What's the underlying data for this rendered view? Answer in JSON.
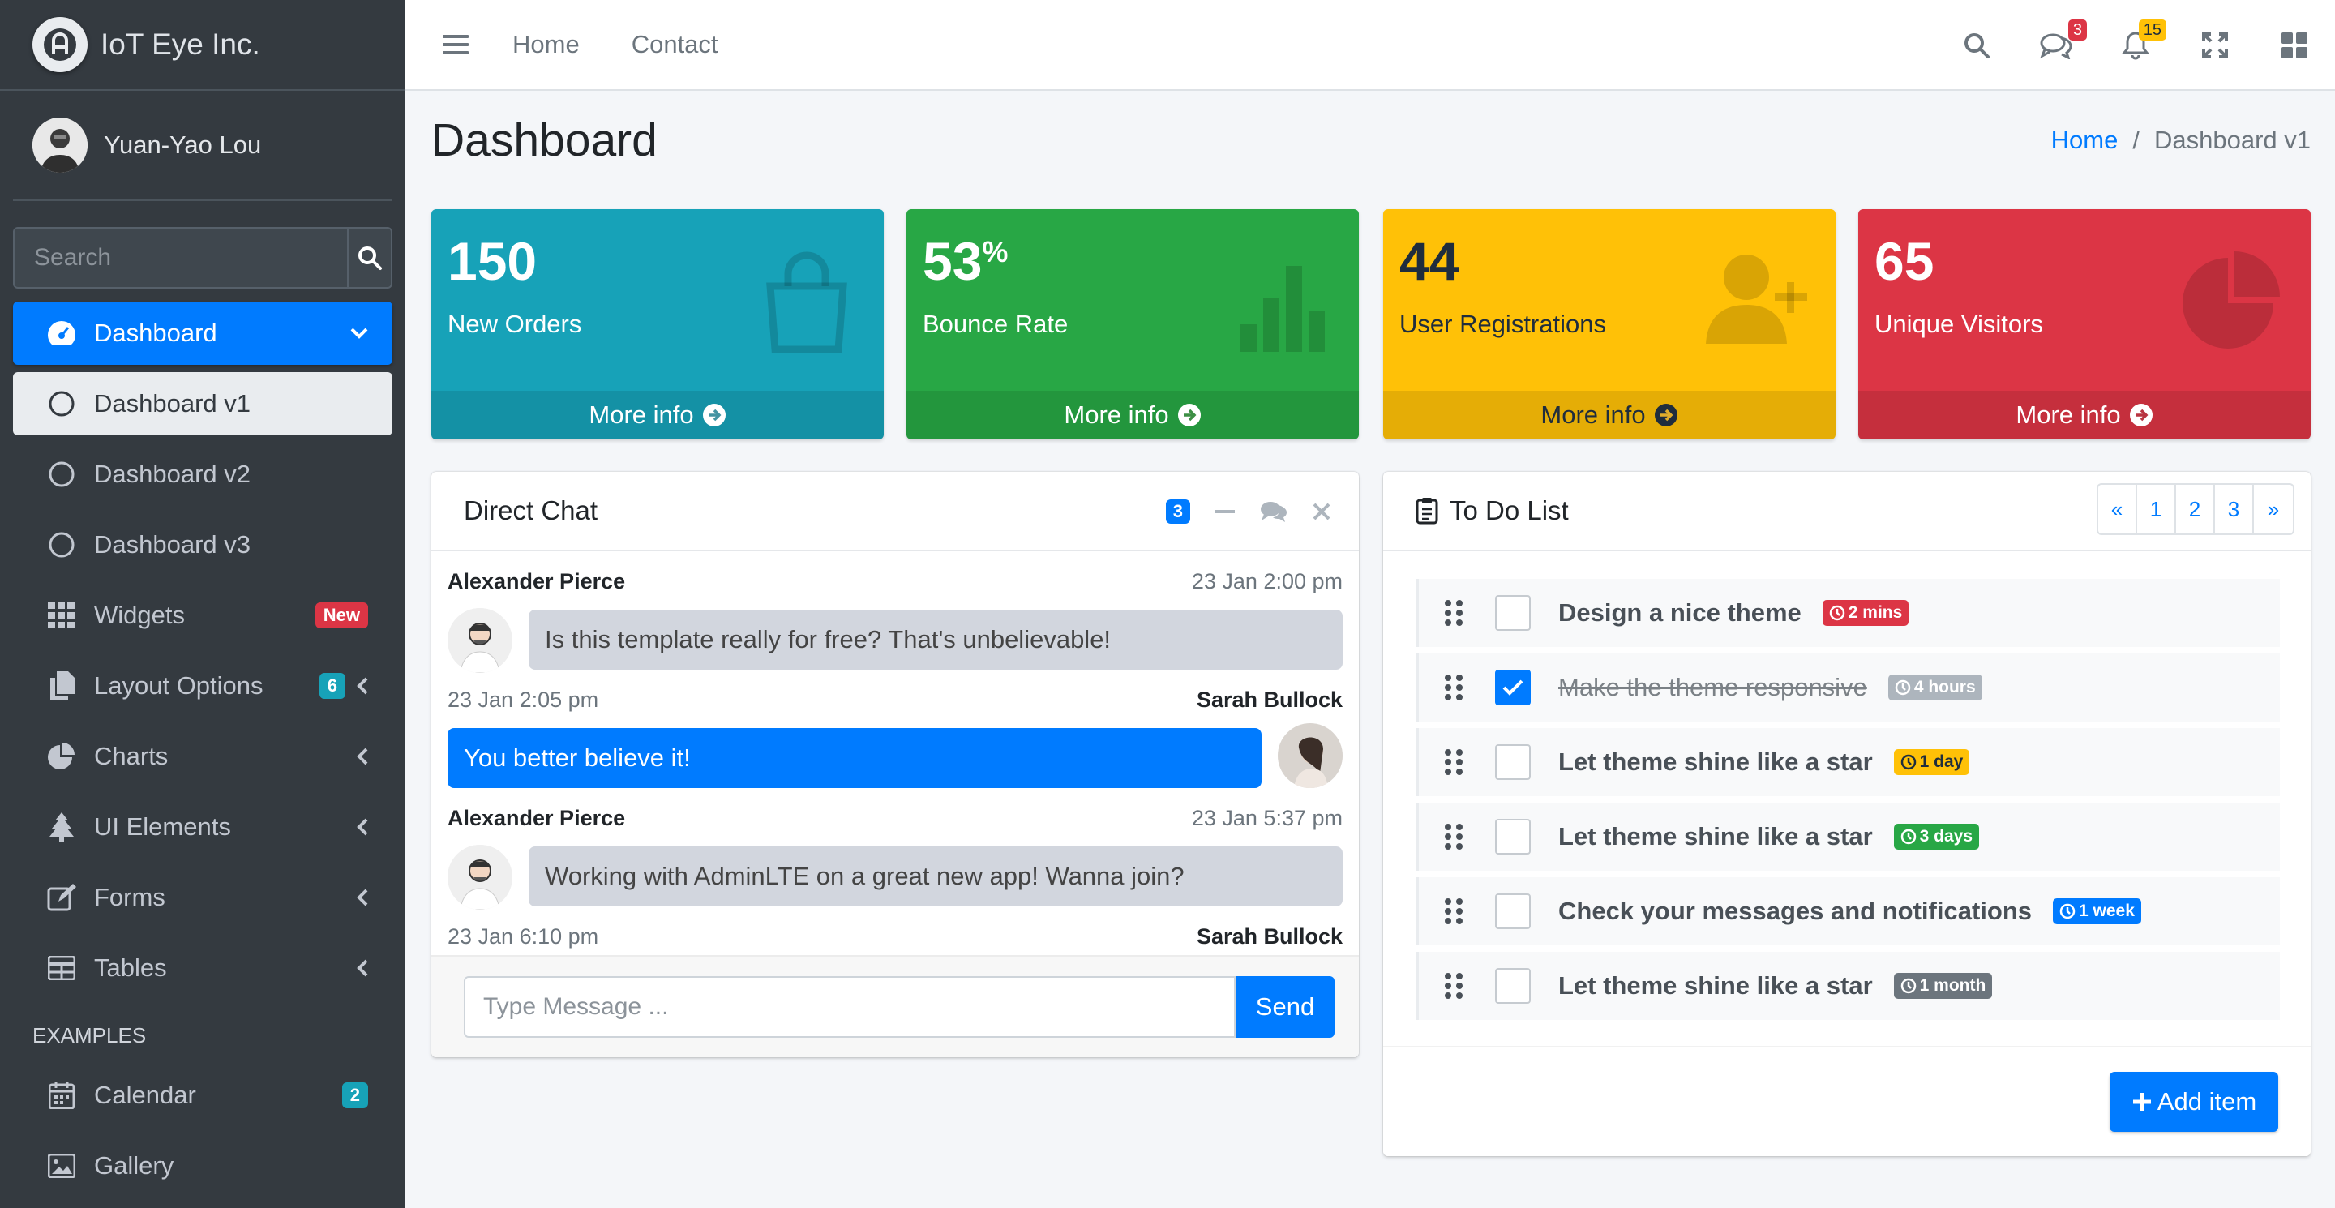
{
  "brand": {
    "name": "IoT Eye Inc."
  },
  "user": {
    "name": "Yuan-Yao Lou"
  },
  "sidebar": {
    "search_placeholder": "Search",
    "items": [
      {
        "label": "Dashboard",
        "icon": "tachometer-icon"
      },
      {
        "label": "Dashboard v1",
        "icon": "circle-icon"
      },
      {
        "label": "Dashboard v2",
        "icon": "circle-icon"
      },
      {
        "label": "Dashboard v3",
        "icon": "circle-icon"
      },
      {
        "label": "Widgets",
        "icon": "grid-icon",
        "badge": "New"
      },
      {
        "label": "Layout Options",
        "icon": "copy-icon",
        "badge": "6"
      },
      {
        "label": "Charts",
        "icon": "pie-chart-icon"
      },
      {
        "label": "UI Elements",
        "icon": "tree-icon"
      },
      {
        "label": "Forms",
        "icon": "edit-icon"
      },
      {
        "label": "Tables",
        "icon": "table-icon"
      }
    ],
    "header": "EXAMPLES",
    "examples": [
      {
        "label": "Calendar",
        "icon": "calendar-icon",
        "badge": "2"
      },
      {
        "label": "Gallery",
        "icon": "image-icon"
      }
    ]
  },
  "topbar": {
    "links": [
      "Home",
      "Contact"
    ],
    "messages_count": "3",
    "notifications_count": "15"
  },
  "page": {
    "title": "Dashboard"
  },
  "breadcrumb": {
    "home": "Home",
    "sep": "/",
    "current": "Dashboard v1"
  },
  "boxes": [
    {
      "value": "150",
      "label": "New Orders",
      "footer": "More info",
      "color": "#17a2b8",
      "icon": "shopping-bag-icon"
    },
    {
      "value": "53",
      "suffix": "%",
      "label": "Bounce Rate",
      "footer": "More info",
      "color": "#28a745",
      "icon": "bar-chart-icon"
    },
    {
      "value": "44",
      "label": "User Registrations",
      "footer": "More info",
      "color": "#ffc107",
      "icon": "user-plus-icon"
    },
    {
      "value": "65",
      "label": "Unique Visitors",
      "footer": "More info",
      "color": "#dc3545",
      "icon": "pie-chart-icon"
    }
  ],
  "chat": {
    "title": "Direct Chat",
    "badge": "3",
    "messages": [
      {
        "name": "Alexander Pierce",
        "time": "23 Jan 2:00 pm",
        "text": "Is this template really for free? That's unbelievable!",
        "side": "left"
      },
      {
        "name": "Sarah Bullock",
        "time": "23 Jan 2:05 pm",
        "text": "You better believe it!",
        "side": "right"
      },
      {
        "name": "Alexander Pierce",
        "time": "23 Jan 5:37 pm",
        "text": "Working with AdminLTE on a great new app! Wanna join?",
        "side": "left"
      },
      {
        "name": "Sarah Bullock",
        "time": "23 Jan 6:10 pm",
        "side": "right"
      }
    ],
    "input_placeholder": "Type Message ...",
    "send_label": "Send"
  },
  "todo": {
    "title": "To Do List",
    "pages": [
      "«",
      "1",
      "2",
      "3",
      "»"
    ],
    "items": [
      {
        "text": "Design a nice theme",
        "tag": "2 mins",
        "tag_color": "#dc3545",
        "done": false
      },
      {
        "text": "Make the theme responsive",
        "tag": "4 hours",
        "tag_color": "#adb5bd",
        "done": true
      },
      {
        "text": "Let theme shine like a star",
        "tag": "1 day",
        "tag_color": "#ffc107",
        "done": false
      },
      {
        "text": "Let theme shine like a star",
        "tag": "3 days",
        "tag_color": "#28a745",
        "done": false
      },
      {
        "text": "Check your messages and notifications",
        "tag": "1 week",
        "tag_color": "#007bff",
        "done": false
      },
      {
        "text": "Let theme shine like a star",
        "tag": "1 month",
        "tag_color": "#6c757d",
        "done": false
      }
    ],
    "add_label": "Add item"
  }
}
